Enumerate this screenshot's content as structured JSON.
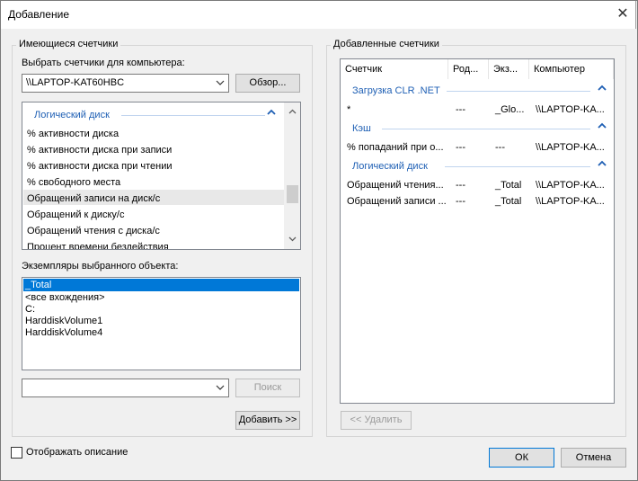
{
  "window": {
    "title": "Добавление",
    "close_icon": "close-icon"
  },
  "available": {
    "group_title": "Имеющиеся счетчики",
    "computer_label": "Выбрать счетчики для компьютера:",
    "computer_value": "\\\\LAPTOP-KAT60HBC",
    "browse_button": "Обзор...",
    "category": "Логический диск",
    "counters": [
      "% активности диска",
      "% активности диска при записи",
      "% активности диска при чтении",
      "% свободного места",
      "Обращений записи на диск/с",
      "Обращений к диску/с",
      "Обращений чтения с диска/с",
      "Процент времени бездействия"
    ],
    "selected_counter": "Обращений записи на диск/с",
    "instances_label": "Экземпляры выбранного объекта:",
    "instances": [
      "_Total",
      "<все вхождения>",
      "C:",
      "HarddiskVolume1",
      "HarddiskVolume4"
    ],
    "selected_instance": "_Total",
    "search_value": "",
    "search_button": "Поиск",
    "add_button": "Добавить >>"
  },
  "added": {
    "group_title": "Добавленные счетчики",
    "columns": [
      "Счетчик",
      "Род...",
      "Экз...",
      "Компьютер"
    ],
    "groups": [
      {
        "name": "Загрузка CLR .NET",
        "rows": [
          [
            "*",
            "---",
            "_Glo...",
            "\\\\LAPTOP-KA..."
          ]
        ]
      },
      {
        "name": "Кэш",
        "rows": [
          [
            "% попаданий при о...",
            "---",
            "---",
            "\\\\LAPTOP-KA..."
          ]
        ]
      },
      {
        "name": "Логический диск",
        "rows": [
          [
            "Обращений чтения...",
            "---",
            "_Total",
            "\\\\LAPTOP-KA..."
          ],
          [
            "Обращений записи ...",
            "---",
            "_Total",
            "\\\\LAPTOP-KA..."
          ]
        ]
      }
    ],
    "remove_button": "<< Удалить"
  },
  "footer": {
    "show_description_label": "Отображать описание",
    "show_description_checked": false,
    "ok_button": "ОК",
    "cancel_button": "Отмена"
  },
  "colors": {
    "accent": "#0078d7",
    "category_text": "#1e5fb4"
  }
}
